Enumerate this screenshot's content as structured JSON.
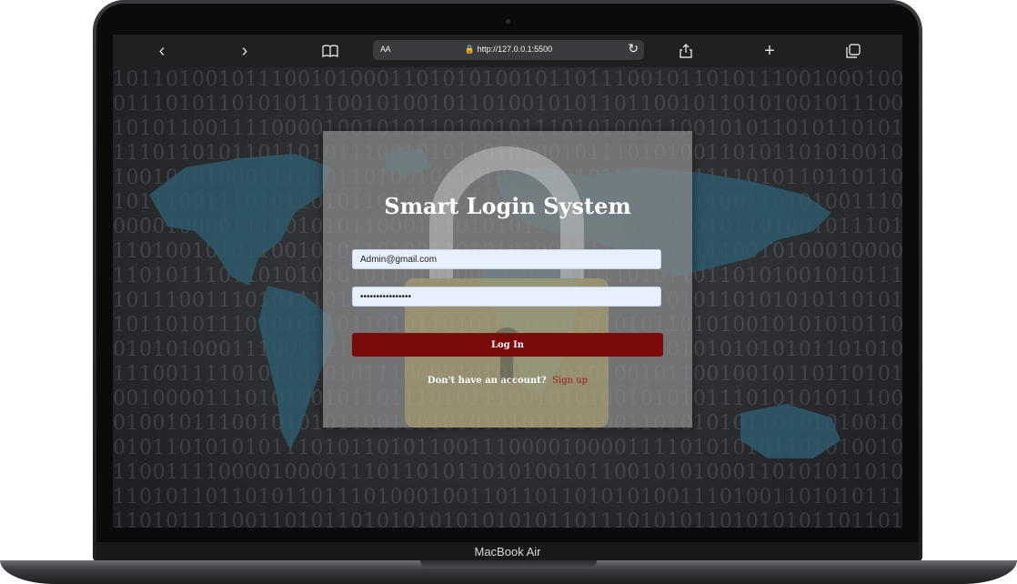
{
  "browser": {
    "url": "http://127.0.0.1:5500",
    "reader_label": "AA"
  },
  "login": {
    "title": "Smart Login System",
    "email_value": "Admin@gmail.com",
    "password_value": "••••••••••••••••",
    "login_label": "Log In",
    "signup_prompt": "Don't have an account?",
    "signup_link": "Sign up"
  },
  "device": {
    "label": "MacBook Air"
  },
  "colors": {
    "login_button": "#7b0a0a",
    "signup_link": "#9a1d1d",
    "input_background": "#e8f0fe"
  }
}
